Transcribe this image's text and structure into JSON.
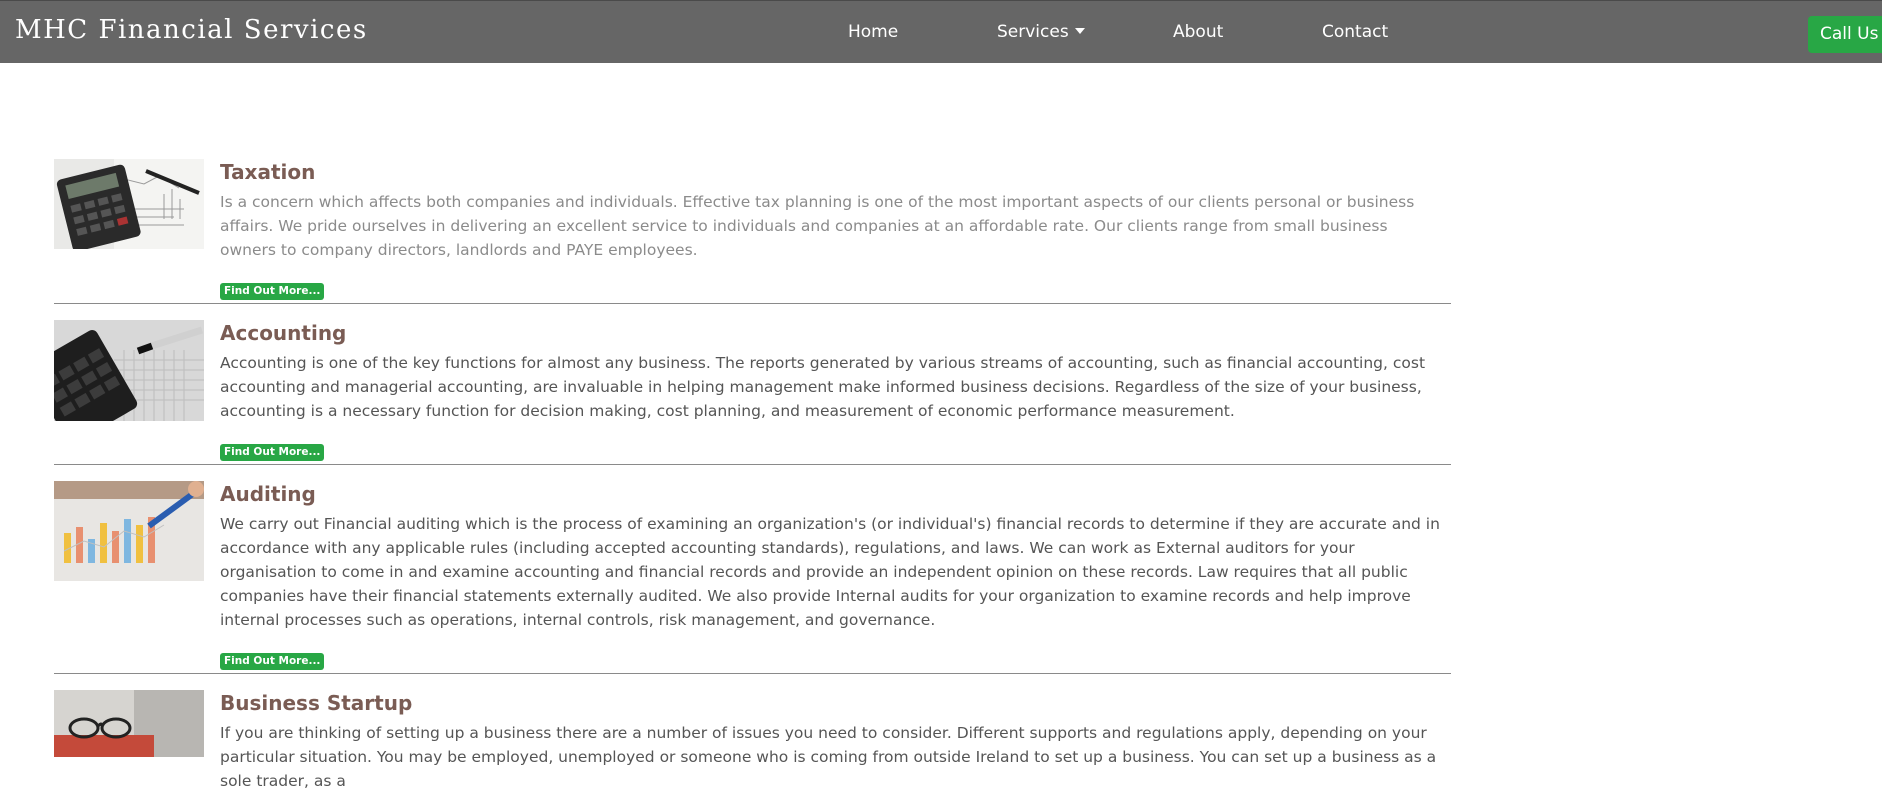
{
  "navbar": {
    "brand": "MHC Financial Services",
    "links": {
      "home": "Home",
      "services": "Services",
      "about": "About",
      "contact": "Contact"
    },
    "call_button": "Call Us"
  },
  "services": [
    {
      "title": "Taxation",
      "text": "Is a concern which affects both companies and individuals. Effective tax planning is one of the most important aspects of our clients personal or business affairs. We pride ourselves in delivering an excellent service to individuals and companies at an affordable rate. Our clients range from small business owners to company directors, landlords and PAYE employees.",
      "button": "Find Out More..."
    },
    {
      "title": "Accounting",
      "text": "Accounting is one of the key functions for almost any business. The reports generated by various streams of accounting, such as financial accounting, cost accounting and managerial accounting, are invaluable in helping management make informed business decisions. Regardless of the size of your business, accounting is a necessary function for decision making, cost planning, and measurement of economic performance measurement.",
      "button": "Find Out More..."
    },
    {
      "title": "Auditing",
      "text": "We carry out Financial auditing which is the process of examining an organization's (or individual's) financial records to determine if they are accurate and in accordance with any applicable rules (including accepted accounting standards), regulations, and laws. We can work as External auditors for your organisation to come in and examine accounting and financial records and provide an independent opinion on these records. Law requires that all public companies have their financial statements externally audited. We also provide Internal audits for your organization to examine records and help improve internal processes such as operations, internal controls, risk management, and governance.",
      "button": "Find Out More..."
    },
    {
      "title": "Business Startup",
      "text": "If you are thinking of setting up a business there are a number of issues you need to consider. Different supports and regulations apply, depending on your particular situation. You may be employed, unemployed or someone who is coming from outside Ireland to set up a business. You can set up a business as a sole trader, as a"
    }
  ],
  "colors": {
    "navbar": "#666666",
    "accent_green": "#28a745",
    "title": "#7a5c54",
    "body_text": "#555555",
    "rule": "#8a8a8a"
  },
  "icons": [
    "calculator-photo",
    "calculator-pen-photo",
    "chart-pen-photo",
    "glasses-paper-photo",
    "caret-down-icon"
  ]
}
